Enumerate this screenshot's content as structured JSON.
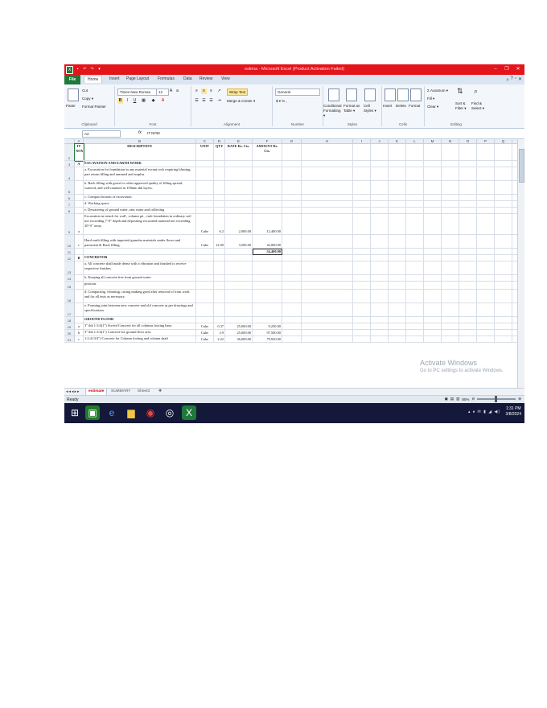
{
  "window": {
    "title": "estima - Microsoft Excel (Product Activation Failed)",
    "controls": [
      "–",
      "❐",
      "✕"
    ]
  },
  "ribbon_tabs": [
    "File",
    "Home",
    "Insert",
    "Page Layout",
    "Formulas",
    "Data",
    "Review",
    "View"
  ],
  "ribbon": {
    "clipboard": {
      "label": "Clipboard",
      "paste": "Paste",
      "cut": "Cut",
      "copy": "Copy ▾",
      "format_painter": "Format Painter"
    },
    "font": {
      "label": "Font",
      "name": "Times New Roman",
      "size": "12"
    },
    "alignment": {
      "label": "Alignment",
      "wrap": "Wrap Text",
      "merge": "Merge & Center ▾"
    },
    "number": {
      "label": "Number",
      "format": "General",
      "symbols": "$ ▾ % ,"
    },
    "styles": {
      "label": "Styles",
      "cond": "Conditional Formatting ▾",
      "table": "Format as Table ▾",
      "cell": "Cell Styles ▾"
    },
    "cells": {
      "label": "Cells",
      "insert": "Insert",
      "delete": "Delete",
      "format": "Format"
    },
    "editing": {
      "label": "Editing",
      "autosum": "Σ AutoSum ▾",
      "fill": "Fill ▾",
      "clear": "Clear ▾",
      "sort": "Sort & Filter ▾",
      "find": "Find & Select ▾"
    }
  },
  "formula_bar": {
    "name_box": "A2",
    "fx": "fx",
    "value": "IT NOM"
  },
  "columns": [
    "A",
    "B",
    "C",
    "D",
    "E",
    "F",
    "G",
    "H",
    "I",
    "J",
    "K",
    "L",
    "M",
    "N",
    "O",
    "P",
    "Q",
    "R"
  ],
  "rows": [
    {
      "n": "2",
      "a": "IT NOM",
      "b": "DESCRIPTION",
      "c": "UNIT",
      "d": "QTY",
      "e": "RATE Rs. Cts.",
      "f": "AMOUNT Rs. Cts."
    },
    {
      "n": "3",
      "a": "A",
      "b": "EXCAVATION AND EARTH WORK"
    },
    {
      "n": "4",
      "b": "a. Excavation for foundation in any material except rock requiring blasting, part return filling and rammed and surplus"
    },
    {
      "n": "5",
      "b": "b. Back filling with gravel or other approved quality of filling spread, watered, and well rammed in 150mm thk layers."
    },
    {
      "n": "6",
      "b": "c. Compact bottom of excavation."
    },
    {
      "n": "7",
      "b": "d. Working space."
    },
    {
      "n": "8",
      "b": "e. Dewatering of ground water, rain water and collecting"
    },
    {
      "n": "9",
      "a": "a",
      "b": "Excavation in trench for wall , column pit , curb foundation in ordinary soil not exceeding 7'-0\" depth and depositing excavated material not exceeding 30'-0\" away.",
      "c": "Cube",
      "d": "6.2",
      "e": "2,000.00",
      "f": "12,400.00"
    },
    {
      "n": "10",
      "a": "c",
      "b": "Hard earth filling with imported granular materials under floors and pavement & Back filling.",
      "c": "Cube",
      "d": "12.00",
      "e": "3,500.00",
      "f": "42,000.00"
    },
    {
      "n": "11",
      "f": "54,400.00"
    },
    {
      "n": "12",
      "a": "B",
      "b": "CONCRETOR"
    },
    {
      "n": "13",
      "b": "a. All concrete shall made dense with a vibration and finished to receive respective finishes."
    },
    {
      "n": "14",
      "b": "b. Keeping all concrete free from ground water."
    },
    {
      "n": "15",
      "b": "position."
    },
    {
      "n": "16",
      "b": "d. Compacting, vibrating, curing making good after removal of from work and for all tests as necessary."
    },
    {
      "n": "17",
      "b": "e. Forming joint between new concrete and old concrete as per drawings and specifications."
    },
    {
      "n": "18",
      "b": "GROUND FLOOR"
    },
    {
      "n": "19",
      "a": "a",
      "b": "3\" thk 1:3:6(1\") Screed Concrete for all columns footing base,",
      "c": "Cube",
      "d": "0.37",
      "e": "25,000.00",
      "f": "9,250.00"
    },
    {
      "n": "20",
      "a": "b",
      "b": "3\" thk 1:3:6(1\") Concrete for ground floor area",
      "c": "Cube",
      "d": "3.9",
      "e": "25,000.00",
      "f": "97,500.00"
    },
    {
      "n": "21",
      "a": "c",
      "b": "1:2:4 (3/4\") Concrete for Column footing and column shaft",
      "c": "Cube",
      "d": "2.22",
      "e": "36,000.00",
      "f": "79,920.00"
    }
  ],
  "sheets": [
    "estimate",
    "SUMMARY",
    "Sheet3"
  ],
  "status": {
    "ready": "Ready",
    "zoom": "80%"
  },
  "activation": {
    "line1": "Activate Windows",
    "line2": "Go to PC settings to activate Windows."
  },
  "clock": {
    "time": "1:31 PM",
    "date": "3/8/2024"
  }
}
